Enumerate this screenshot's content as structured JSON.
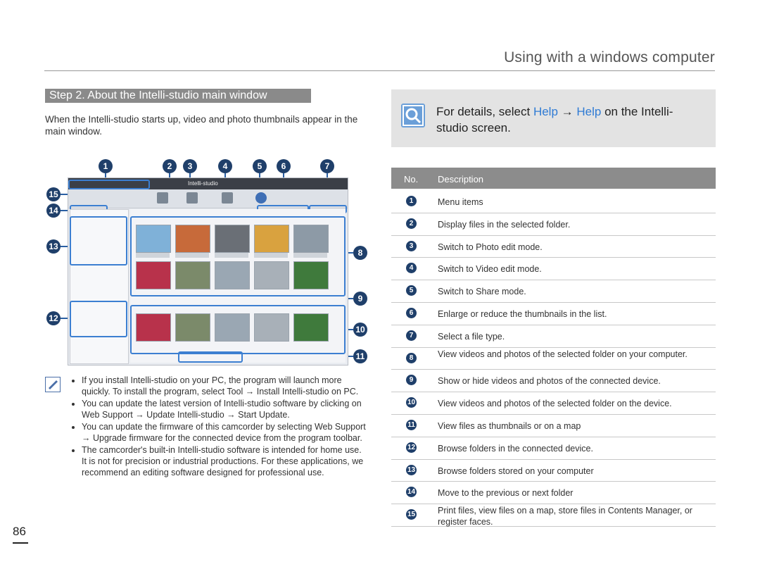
{
  "page": {
    "header_title": "Using with a windows computer",
    "step_heading": "Step 2. About the Intelli-studio main window",
    "intro": "When the Intelli-studio starts up, video and photo thumbnails appear in the main window.",
    "page_number": "86"
  },
  "screenshot": {
    "app_name": "Intelli-studio",
    "markers_top": [
      "1",
      "2",
      "3",
      "4",
      "5",
      "6",
      "7"
    ],
    "markers_left": [
      "15",
      "14",
      "13",
      "12"
    ],
    "markers_right": [
      "8",
      "9",
      "10",
      "11"
    ]
  },
  "notes": [
    "If you install Intelli-studio on your PC, the program will launch more quickly. To install the program, select Tool → Install Intelli-studio on PC.",
    "You can update the latest version of Intelli-studio software by clicking on Web Support → Update Intelli-studio → Start Update.",
    "You can update the firmware of this camcorder by selecting Web Support → Upgrade firmware for the connected device from the program toolbar.",
    "The camcorder's built-in Intelli-studio software is intended for home use. It is not for precision or industrial productions. For these applications, we recommend an editing software designed for professional use."
  ],
  "info": {
    "prefix": "For details, select ",
    "help1": "Help",
    "arrow": " → ",
    "help2": "Help",
    "suffix": " on the Intelli-studio screen."
  },
  "table": {
    "col_no": "No.",
    "col_desc": "Description",
    "rows": [
      {
        "no": "1",
        "desc": "Menu items"
      },
      {
        "no": "2",
        "desc": "Display files in the selected folder."
      },
      {
        "no": "3",
        "desc": "Switch to Photo edit mode."
      },
      {
        "no": "4",
        "desc": "Switch to Video edit mode."
      },
      {
        "no": "5",
        "desc": "Switch to Share mode."
      },
      {
        "no": "6",
        "desc": "Enlarge or reduce the thumbnails in the list."
      },
      {
        "no": "7",
        "desc": "Select a file type."
      },
      {
        "no": "8",
        "desc": "View videos and photos of the selected folder on your computer."
      },
      {
        "no": "9",
        "desc": "Show or hide videos and photos of the connected device."
      },
      {
        "no": "10",
        "desc": "View videos and photos of the selected folder on the device."
      },
      {
        "no": "11",
        "desc": "View files as thumbnails or on a map"
      },
      {
        "no": "12",
        "desc": "Browse folders in the connected device."
      },
      {
        "no": "13",
        "desc": "Browse folders stored on your computer"
      },
      {
        "no": "14",
        "desc": "Move to the previous or next folder"
      },
      {
        "no": "15",
        "desc": "Print files, view files on a map, store files in Contents Manager, or register faces."
      }
    ]
  }
}
